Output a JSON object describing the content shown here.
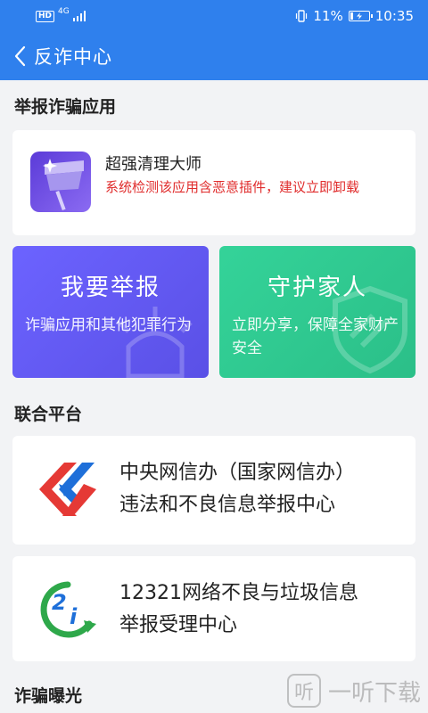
{
  "status_bar": {
    "hd": "HD",
    "network": "4G",
    "battery_text": "11%",
    "time": "10:35"
  },
  "header": {
    "title": "反诈中心",
    "back_icon": "chevron-left-icon"
  },
  "report_app_section": {
    "heading": "举报诈骗应用",
    "app": {
      "name": "超强清理大师",
      "warning": "系统检测该应用含恶意插件，建议立即卸载",
      "icon": "broom-app-icon"
    }
  },
  "actions": {
    "report": {
      "title": "我要举报",
      "desc": "诈骗应用和其他犯罪行为",
      "color": "#6c63ff"
    },
    "family": {
      "title": "守护家人",
      "desc": "立即分享，保障全家财产安全",
      "color": "#34d399"
    }
  },
  "joint_platform_section": {
    "heading": "联合平台",
    "platforms": [
      {
        "line1": "中央网信办（国家网信办）",
        "line2": "违法和不良信息举报中心",
        "logo": "cac-report-logo"
      },
      {
        "line1": "12321网络不良与垃圾信息",
        "line2": "举报受理中心",
        "logo": "12321-logo"
      }
    ]
  },
  "exposure_section": {
    "heading": "诈骗曝光"
  },
  "watermark": {
    "icon_char": "听",
    "text": "一听下载"
  },
  "colors": {
    "primary": "#2f80ed",
    "warning": "#e02c2c",
    "background": "#f2f3f5"
  }
}
